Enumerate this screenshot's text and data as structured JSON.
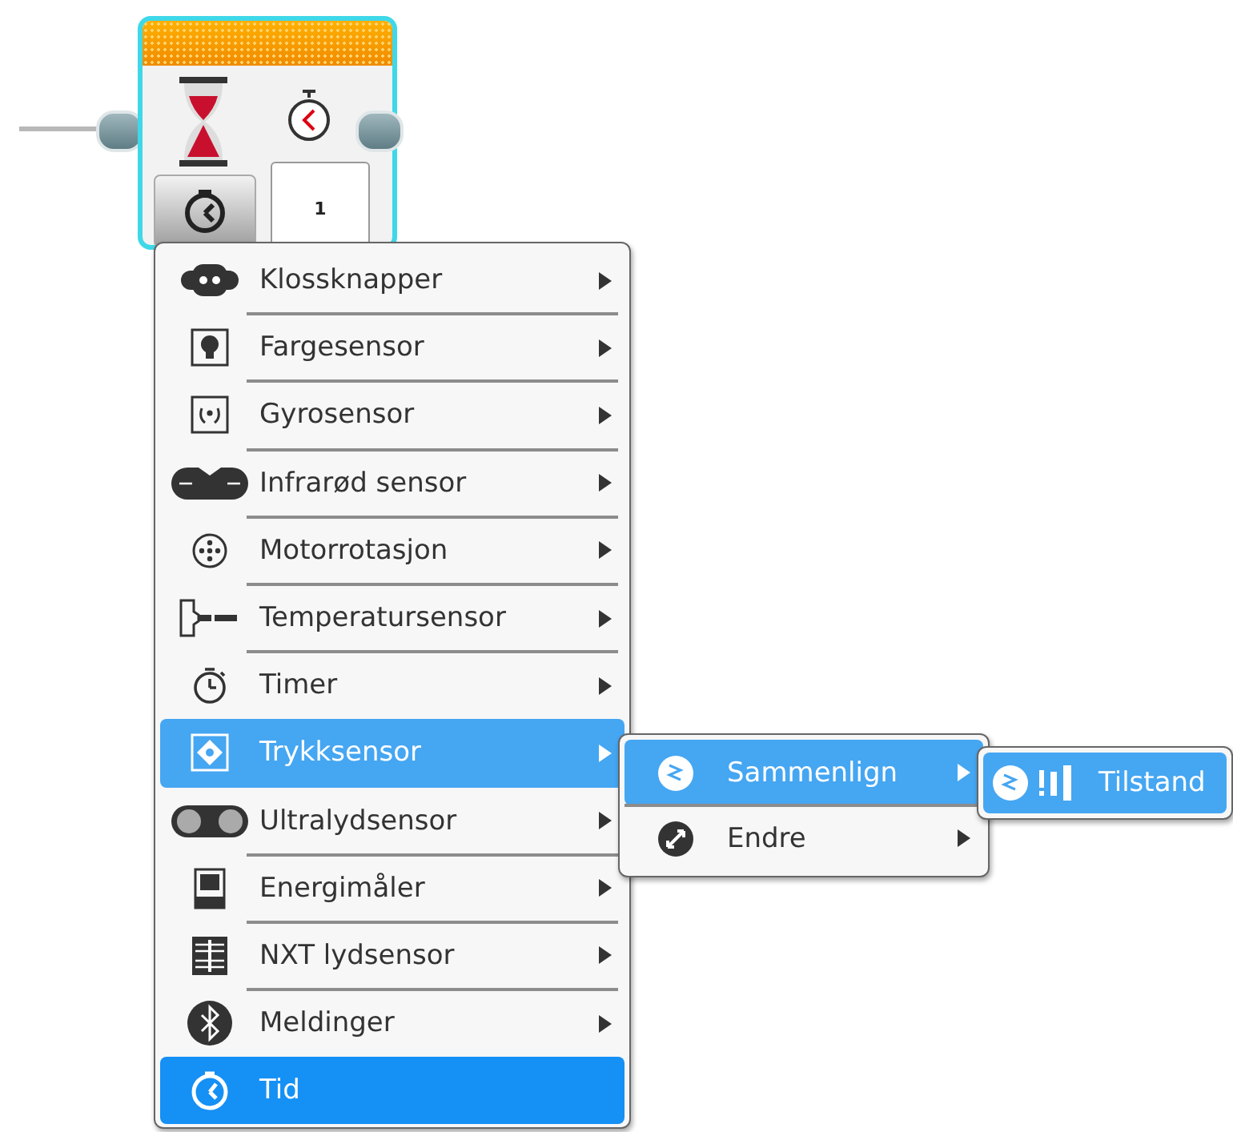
{
  "block": {
    "value": "1"
  },
  "menu": {
    "items": [
      {
        "label": "Klossknapper",
        "submenu": true,
        "highlighted": false,
        "selected": false
      },
      {
        "label": "Fargesensor",
        "submenu": true,
        "highlighted": false,
        "selected": false
      },
      {
        "label": "Gyrosensor",
        "submenu": true,
        "highlighted": false,
        "selected": false
      },
      {
        "label": "Infrarød sensor",
        "submenu": true,
        "highlighted": false,
        "selected": false
      },
      {
        "label": "Motorrotasjon",
        "submenu": true,
        "highlighted": false,
        "selected": false
      },
      {
        "label": "Temperatursensor",
        "submenu": true,
        "highlighted": false,
        "selected": false
      },
      {
        "label": "Timer",
        "submenu": true,
        "highlighted": false,
        "selected": false
      },
      {
        "label": "Trykksensor",
        "submenu": true,
        "highlighted": true,
        "selected": false
      },
      {
        "label": "Ultralydsensor",
        "submenu": true,
        "highlighted": false,
        "selected": false
      },
      {
        "label": "Energimåler",
        "submenu": true,
        "highlighted": false,
        "selected": false
      },
      {
        "label": "NXT lydsensor",
        "submenu": true,
        "highlighted": false,
        "selected": false
      },
      {
        "label": "Meldinger",
        "submenu": true,
        "highlighted": false,
        "selected": false
      },
      {
        "label": "Tid",
        "submenu": false,
        "highlighted": false,
        "selected": true
      }
    ]
  },
  "submenu": {
    "items": [
      {
        "label": "Sammenlign",
        "submenu": true,
        "highlighted": true
      },
      {
        "label": "Endre",
        "submenu": true,
        "highlighted": false
      }
    ]
  },
  "submenu_2": {
    "items": [
      {
        "label": "Tilstand",
        "highlighted": true
      }
    ]
  }
}
